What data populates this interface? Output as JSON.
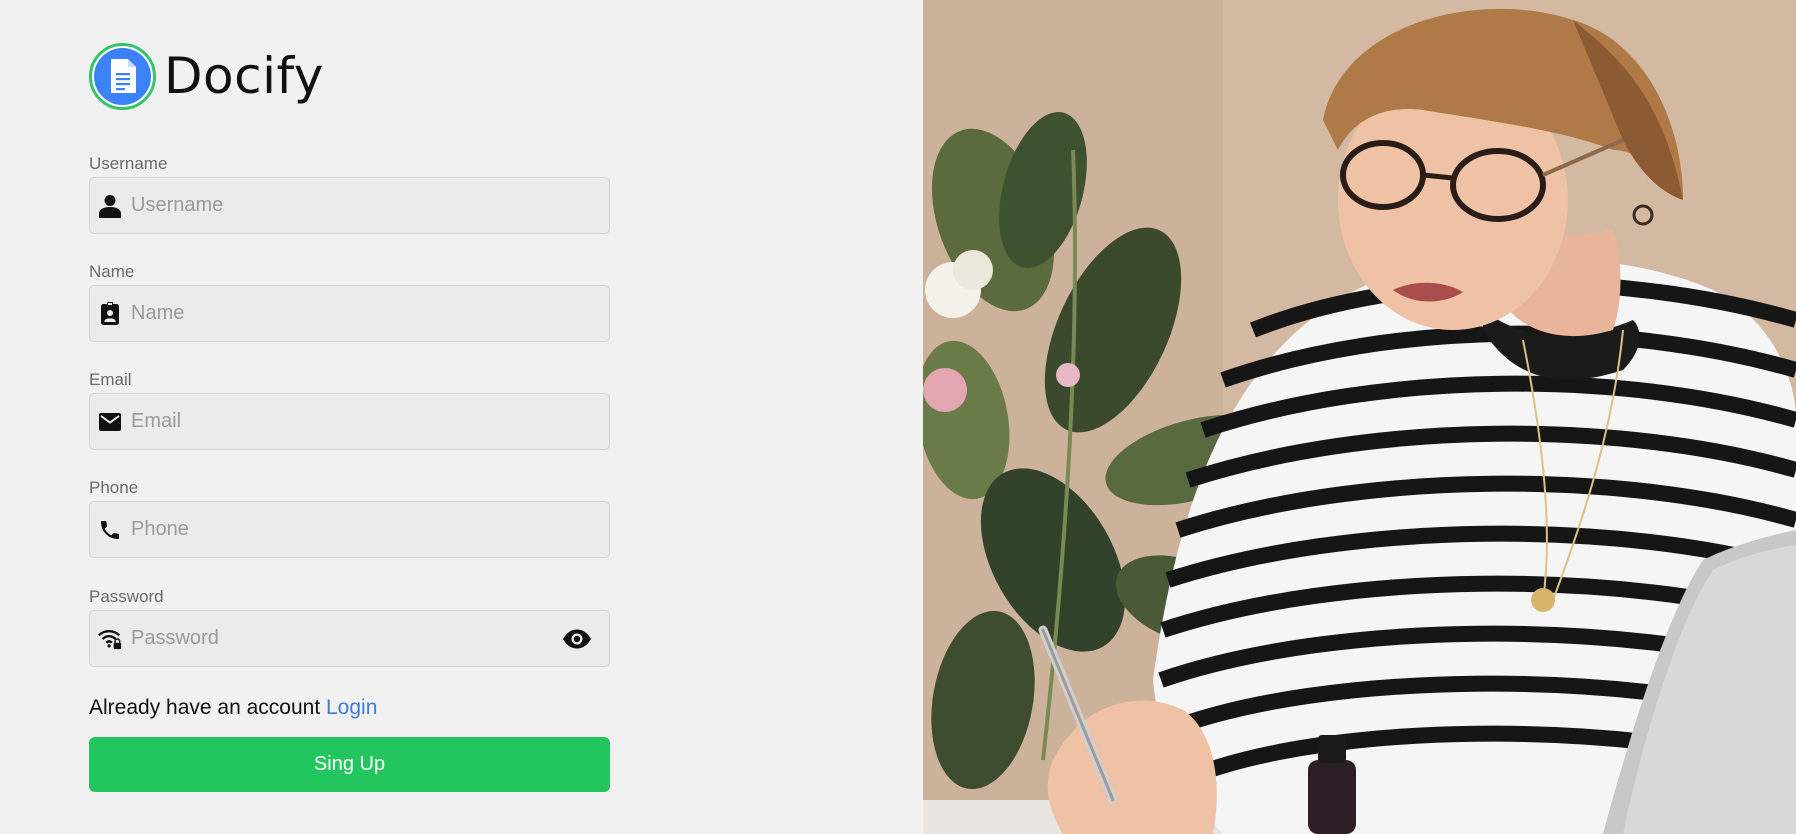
{
  "brand": {
    "name": "Docify",
    "colors": {
      "ring": "#34c46a",
      "badge": "#3b82f6"
    }
  },
  "form": {
    "fields": [
      {
        "label": "Username",
        "placeholder": "Username",
        "value": "",
        "icon": "person-icon"
      },
      {
        "label": "Name",
        "placeholder": "Name",
        "value": "",
        "icon": "contact-badge-icon"
      },
      {
        "label": "Email",
        "placeholder": "Email",
        "value": "",
        "icon": "envelope-icon"
      },
      {
        "label": "Phone",
        "placeholder": "Phone",
        "value": "",
        "icon": "phone-icon"
      },
      {
        "label": "Password",
        "placeholder": "Password",
        "value": "",
        "icon": "wifi-lock-icon",
        "toggle_icon": "eye-icon"
      }
    ],
    "login_prompt": "Already have an account",
    "login_link": "Login",
    "submit_label": "Sing Up",
    "accent": "#22c55e",
    "link_color": "#3b7dd8"
  },
  "hero_image": {
    "subject": "woman-writing-photo"
  }
}
